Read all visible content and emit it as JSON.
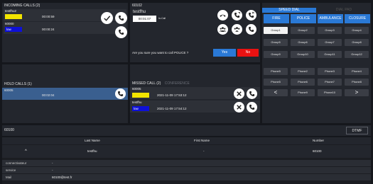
{
  "incoming": {
    "title": "INCOMING CALLS (2)",
    "calls": [
      {
        "name": "testfhu2",
        "status": "",
        "status_color": "#f2e400",
        "time": "00:00:59"
      },
      {
        "name": "60000",
        "status": "low",
        "status_color": "#0e10d8",
        "time": "00:00:24"
      }
    ]
  },
  "active": {
    "number": "60102",
    "caller": "testfhu",
    "timer": "00:01:07",
    "state": "In-Call",
    "confirm_text": "Are you sure you want to call POLICE ?",
    "yes": "Yes",
    "no": "No"
  },
  "speed_dial": {
    "title": "SPEED DIAL",
    "extra_tab": "DIAL PAD",
    "tabs": [
      {
        "label": "FIRE",
        "color": "#2a79d6"
      },
      {
        "label": "POLICE",
        "color": "#2a79d6"
      },
      {
        "label": "AMBULANCE",
        "color": "#2a79d6"
      },
      {
        "label": "CLOSURE",
        "color": "#2a79d6"
      }
    ],
    "groups": [
      "Group1",
      "Group2",
      "Group3",
      "Group4",
      "Group5",
      "Group6",
      "Group7",
      "Group8",
      "Group9",
      "Group10",
      "Group11",
      "Group12"
    ],
    "phones": [
      "Phone5",
      "Phone2",
      "Phone3",
      "Phone4",
      "Phone5",
      "Phone6",
      "Phone7",
      "Phone8"
    ],
    "phones_last": [
      "Phone9",
      "Phone10"
    ],
    "prev": "<",
    "next": ">"
  },
  "hold": {
    "title": "HOLD CALLS (1)",
    "call": {
      "name": "60005",
      "time": "00:02:04"
    }
  },
  "missed": {
    "title": "MISSED CALL (2)",
    "tab2": "CONFERENCE",
    "calls": [
      {
        "name": "60005",
        "status": "",
        "status_color": "#f2e400",
        "date": "2021-11-09 17:53:12"
      },
      {
        "name": "testfhu",
        "status": "low",
        "status_color": "#0e10d8",
        "date": "2021-11-09 17:54:12"
      }
    ]
  },
  "dial": {
    "value": "60100",
    "dtmf": "DTMF"
  },
  "contacts": {
    "headers": [
      "Last Name",
      "First Name",
      "Number"
    ],
    "row": {
      "toggle": "^",
      "last": "testfhu",
      "first": "-",
      "number": "60100"
    },
    "details": [
      {
        "key": "connectivateur",
        "value": "-"
      },
      {
        "key": "service",
        "value": "-"
      },
      {
        "key": "Mail",
        "value": "60100@test.fr"
      }
    ]
  }
}
